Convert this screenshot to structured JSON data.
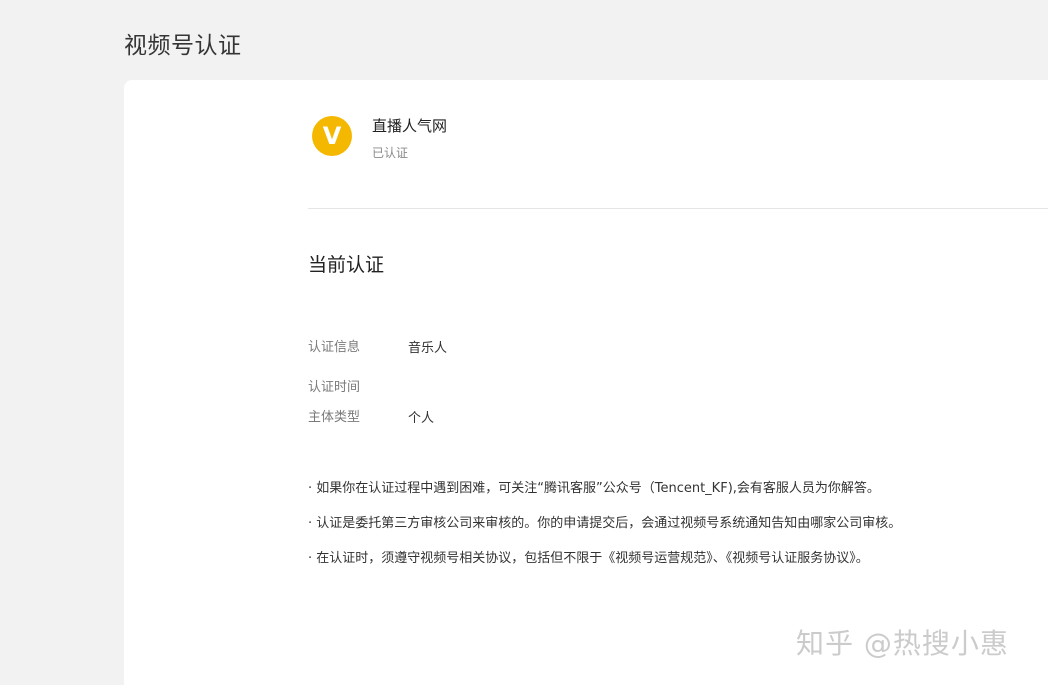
{
  "page": {
    "title": "视频号认证"
  },
  "account": {
    "avatar_letter": "V",
    "name": "直播人气网",
    "status": "已认证"
  },
  "current_cert": {
    "section_title": "当前认证",
    "rows": [
      {
        "label": "认证信息",
        "value": "音乐人"
      },
      {
        "label": "认证时间",
        "value": ""
      },
      {
        "label": "主体类型",
        "value": "个人"
      }
    ]
  },
  "notes": [
    "· 如果你在认证过程中遇到困难，可关注“腾讯客服”公众号（Tencent_KF),会有客服人员为你解答。",
    "· 认证是委托第三方审核公司来审核的。你的申请提交后，会通过视频号系统通知告知由哪家公司审核。",
    "· 在认证时，须遵守视频号相关协议，包括但不限于《视频号运营规范》、《视频号认证服务协议》。"
  ],
  "watermark": "知乎 @热搜小惠",
  "colors": {
    "avatar_bg": "#f5b800",
    "page_bg": "#f2f2f2",
    "card_bg": "#ffffff"
  }
}
